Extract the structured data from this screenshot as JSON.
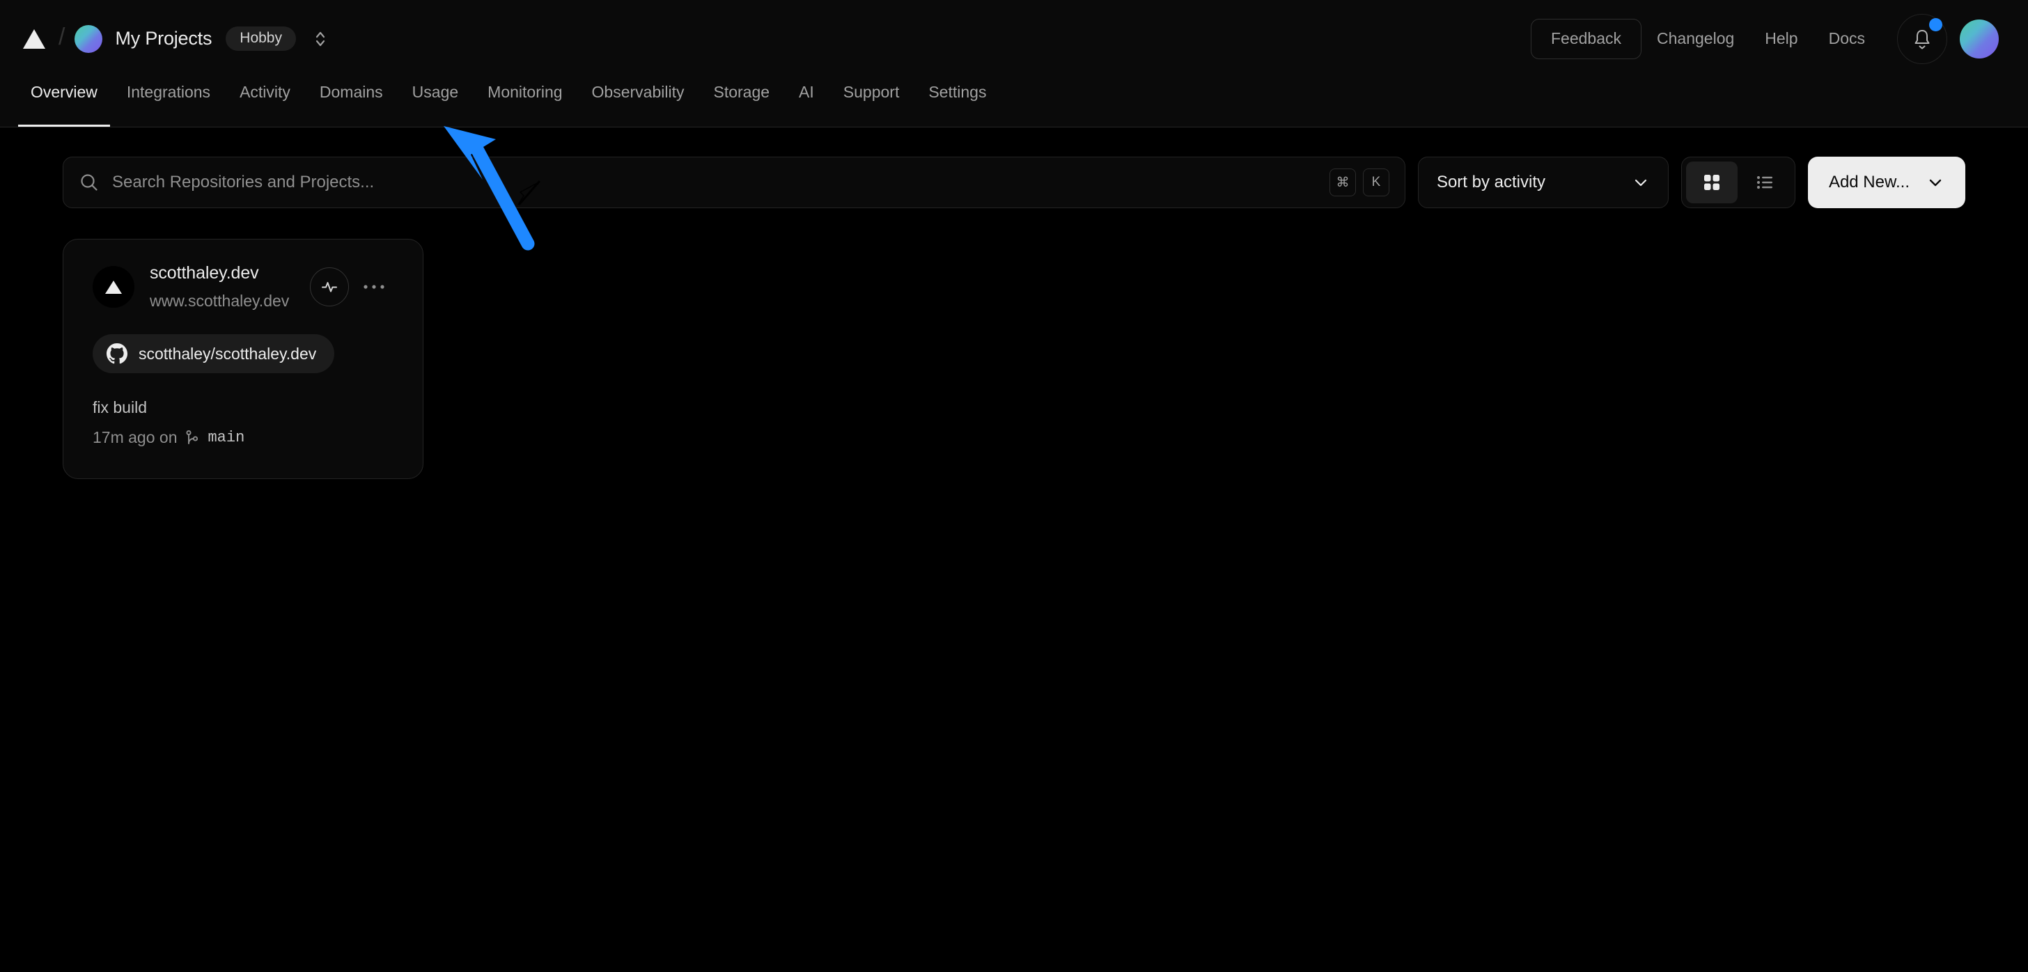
{
  "header": {
    "logo_icon": "vercel-triangle-icon",
    "separator": "/",
    "team_name": "My Projects",
    "plan_badge": "Hobby",
    "scope_switcher_icon": "chevron-up-down-icon",
    "feedback_label": "Feedback",
    "links": [
      {
        "label": "Changelog"
      },
      {
        "label": "Help"
      },
      {
        "label": "Docs"
      }
    ],
    "notifications_icon": "bell-icon",
    "notifications_has_unread": true,
    "avatar_icon": "user-avatar",
    "accent_blue": "#1e88ff",
    "avatar_gradient_from": "#4ec9a5",
    "avatar_gradient_to": "#7c5ce8"
  },
  "tabs": [
    {
      "label": "Overview",
      "active": true
    },
    {
      "label": "Integrations",
      "active": false
    },
    {
      "label": "Activity",
      "active": false
    },
    {
      "label": "Domains",
      "active": false
    },
    {
      "label": "Usage",
      "active": false
    },
    {
      "label": "Monitoring",
      "active": false
    },
    {
      "label": "Observability",
      "active": false
    },
    {
      "label": "Storage",
      "active": false
    },
    {
      "label": "AI",
      "active": false
    },
    {
      "label": "Support",
      "active": false
    },
    {
      "label": "Settings",
      "active": false
    }
  ],
  "toolbar": {
    "search_placeholder": "Search Repositories and Projects...",
    "search_value": "",
    "search_icon": "search-icon",
    "shortcut_keys": [
      "⌘",
      "K"
    ],
    "sort_label": "Sort by activity",
    "sort_chevron_icon": "chevron-down-icon",
    "view_grid_icon": "grid-view-icon",
    "view_list_icon": "list-view-icon",
    "view_active": "grid",
    "add_new_label": "Add New...",
    "add_new_chevron_icon": "chevron-down-icon"
  },
  "projects": [
    {
      "avatar_icon": "vercel-triangle-icon",
      "name": "scotthaley.dev",
      "domain": "www.scotthaley.dev",
      "activity_icon": "activity-pulse-icon",
      "menu_icon": "more-horizontal-icon",
      "repo_icon": "github-icon",
      "repo": "scotthaley/scotthaley.dev",
      "commit_message": "fix build",
      "commit_time": "17m ago on",
      "branch_icon": "git-branch-icon",
      "branch": "main"
    }
  ],
  "annotations": {
    "arrow_color": "#1e88ff",
    "arrow_target": "Domains",
    "cursor_icon": "mouse-cursor-icon"
  }
}
